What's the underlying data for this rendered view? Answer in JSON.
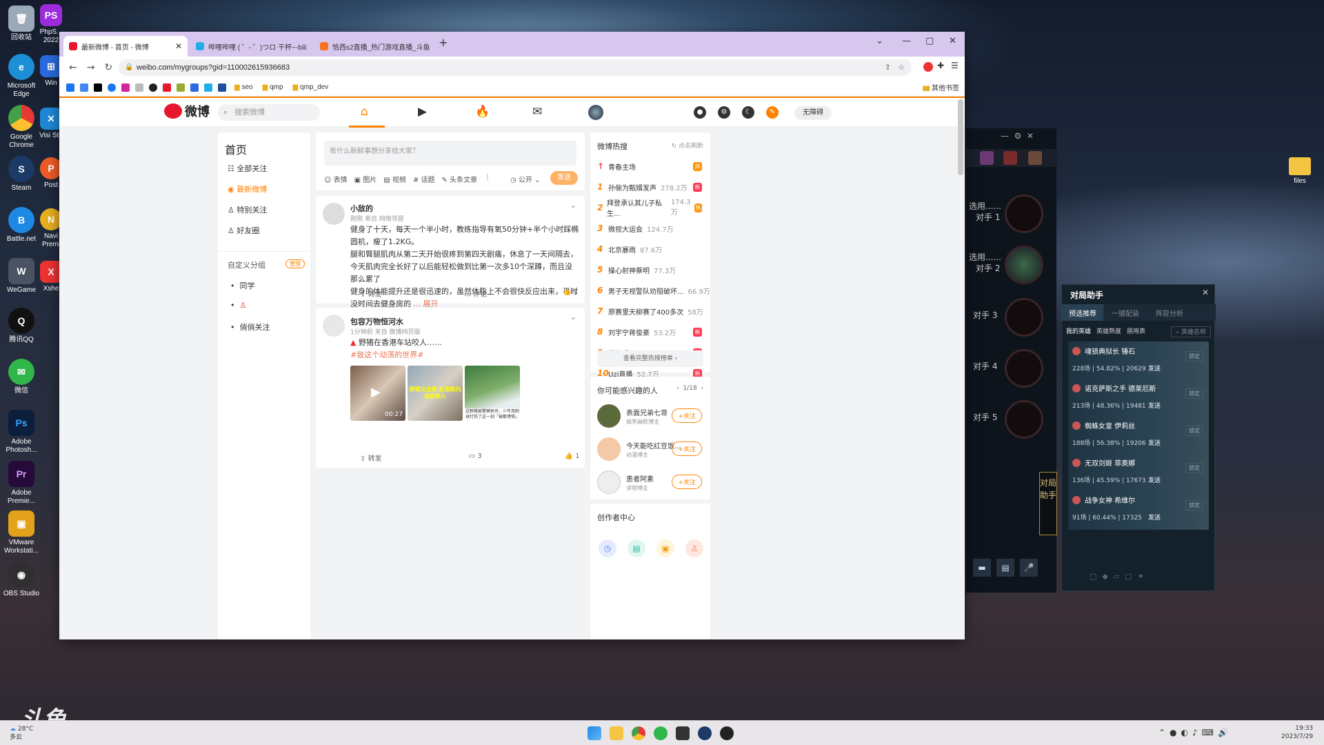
{
  "desktop": {
    "icons": [
      {
        "label": "回收站",
        "color": "#9aa8b8"
      },
      {
        "label": "Microsoft Edge",
        "color": "#1c8fd6"
      },
      {
        "label": "Google Chrome",
        "color": "#e53935"
      },
      {
        "label": "Steam",
        "color": "#1b3a66"
      },
      {
        "label": "Battle.net",
        "color": "#1e88e5"
      },
      {
        "label": "WeGame",
        "color": "#4a5361"
      },
      {
        "label": "腾讯QQ",
        "color": "#111"
      },
      {
        "label": "微信",
        "color": "#31b64a"
      },
      {
        "label": "Adobe Photosh...",
        "color": "#0d1d3c"
      },
      {
        "label": "Adobe Premie...",
        "color": "#260a3a"
      },
      {
        "label": "VMware Workstati...",
        "color": "#e3a21a"
      },
      {
        "label": "OBS Studio",
        "color": "#302e31"
      }
    ],
    "col2": [
      {
        "label": "PhpS... 2022",
        "color": "#9b2bdb"
      },
      {
        "label": "Win",
        "color": "#2b6be0"
      },
      {
        "label": "Visi Stu",
        "color": "#1f88d8"
      },
      {
        "label": "Post",
        "color": "#ef5b25"
      },
      {
        "label": "Navi Premi",
        "color": "#e7b020"
      },
      {
        "label": "Xshe",
        "color": "#e33"
      }
    ],
    "right_folder": "files",
    "watermark": "斗鱼"
  },
  "browser": {
    "tabs": [
      {
        "title": "最新微博 - 首页 - 微博",
        "color": "#e6162d"
      },
      {
        "title": "哔哩哔哩 ( ゜- ゜)つロ 干杯~-bili",
        "color": "#23ade5"
      },
      {
        "title": "恰西s2直播_热门游戏直播_斗鱼",
        "color": "#f8731d"
      }
    ],
    "new_tab": "+",
    "url": "weibo.com/mygroups?gid=110002615936683",
    "bookmarks": [
      "seo",
      "qmp",
      "qmp_dev"
    ],
    "other_bookmarks": "其他书签"
  },
  "weibo": {
    "logo": "微博",
    "logo_sub": "weibo.com",
    "search_placeholder": "搜索微博",
    "accessibility": "无障碍",
    "sidebar": {
      "title": "首页",
      "items": [
        "全部关注",
        "最新微博",
        "特别关注",
        "好友圈"
      ],
      "custom_group": "自定义分组",
      "manage": "管理",
      "groups": [
        "同学",
        "",
        "俏俏关注"
      ]
    },
    "composer": {
      "placeholder": "有什么新鲜事想分享给大家？",
      "tools": [
        "表情",
        "图片",
        "视频",
        "话题",
        "头条文章"
      ],
      "visibility": "公开",
      "send": "发送"
    },
    "posts": [
      {
        "user": "小敌的",
        "meta": "刚刚 来自 网络邻居",
        "text": "健身了十天，每天一个半小时，教练指导有氧50分钟+半个小时踩椭圆机，瘦了1.2KG。",
        "text2": "腿和臀腿肌肉从第二天开始很疼到第四天剧痛，休息了一天间隔去，今天肌肉完全长好了以后能轻松做到比第一次多10个深蹲，而且没那么累了",
        "text3": "健身的体能提升还是很迅速的，虽然体脂上不会很快反应出来，平时没时间去健身房的",
        "more": "... 展开",
        "repost": "转发",
        "comment": "评论",
        "like": "1"
      },
      {
        "user": "包容万物恒河水",
        "meta": "1分钟前 来自 微博网页版",
        "text": "野猪在香港车站咬人……",
        "topic": "#致这个动荡的世界#",
        "video_time": "00:27",
        "img2_caption": "野猪又出现 在港铁内连伤两人",
        "img3_caption": "近野猪被警察射杀，少年用刺球打伤了这一刻「被都博悟」",
        "repost": "转发",
        "comment": "3",
        "like": "1"
      }
    ],
    "hot": {
      "title": "微博热搜",
      "refresh": "点击刷新",
      "pinned": "青春主场",
      "items": [
        {
          "rank": "1",
          "text": "孙俪为甄嬛发声",
          "num": "278.2万",
          "badge": "新",
          "bc": "#ff3852"
        },
        {
          "rank": "2",
          "text": "拜登承认其儿子私生...",
          "num": "174.3万",
          "badge": "热",
          "bc": "#ff9406"
        },
        {
          "rank": "3",
          "text": "微视大运会",
          "num": "124.7万",
          "badge": "",
          "bc": ""
        },
        {
          "rank": "4",
          "text": "北京暴雨",
          "num": "87.6万",
          "badge": "",
          "bc": ""
        },
        {
          "rank": "5",
          "text": "操心射神蔡明",
          "num": "77.3万",
          "badge": "",
          "bc": ""
        },
        {
          "rank": "6",
          "text": "男子无视警队劝阻破坏...",
          "num": "66.9万",
          "badge": "",
          "bc": ""
        },
        {
          "rank": "7",
          "text": "原赛里天柳赛了400多次",
          "num": "58万",
          "badge": "",
          "bc": ""
        },
        {
          "rank": "8",
          "text": "刘宇宁蒋俊豪",
          "num": "53.2万",
          "badge": "新",
          "bc": "#ff3852"
        },
        {
          "rank": "9",
          "text": "种地吧",
          "num": "52.7万",
          "badge": "新",
          "bc": "#ff3852"
        },
        {
          "rank": "10",
          "text": "Uzi直播",
          "num": "52.7万",
          "badge": "新",
          "bc": "#ff3852"
        }
      ],
      "see_all": "查看完整热搜榜单"
    },
    "suggest": {
      "title": "你可能感兴趣的人",
      "page": "1/18",
      "people": [
        {
          "name": "表面兄弟七哥",
          "desc": "搞笑幽默博主",
          "follow": "+关注"
        },
        {
          "name": "今天能吃红豆饭...",
          "desc": "动漫博主",
          "follow": "+关注"
        },
        {
          "name": "患者阿素",
          "desc": "读物博主",
          "follow": "+关注"
        }
      ]
    },
    "creator": {
      "title": "创作者中心"
    }
  },
  "game": {
    "slots": [
      "选用......",
      "选用......",
      "对手 3",
      "对手 4",
      "对手 5"
    ],
    "slot_sub": [
      "对手 1",
      "对手 2"
    ],
    "side_label": "对局助手"
  },
  "helper": {
    "title": "对局助手",
    "tabs": [
      "预选推荐",
      "一键配装",
      "阵容分析"
    ],
    "subtabs": [
      "我的英雄",
      "英雄熟度",
      "朋用表"
    ],
    "search": "英雄名称",
    "heroes": [
      {
        "name": "魂锁典狱长 锤石",
        "stats": "228场 | 54.82% | 20629",
        "send": "发送",
        "lock": "锁定"
      },
      {
        "name": "诺克萨斯之手 德莱厄斯",
        "stats": "213场 | 48.36% | 19481",
        "send": "发送",
        "lock": "锁定"
      },
      {
        "name": "蜘蛛女皇 伊莉丝",
        "stats": "188场 | 56.38% | 19206",
        "send": "发送",
        "lock": "锁定"
      },
      {
        "name": "无双剑姬 菲奥娜",
        "stats": "136场 | 45.59% | 17673",
        "send": "发送",
        "lock": "锁定"
      },
      {
        "name": "战争女神 希维尔",
        "stats": "91场 | 60.44% | 17325",
        "send": "发送",
        "lock": "锁定"
      }
    ]
  },
  "taskbar": {
    "weather": "多云",
    "weather_temp": "28°C",
    "time": "19:33",
    "date": "2023/7/29"
  }
}
